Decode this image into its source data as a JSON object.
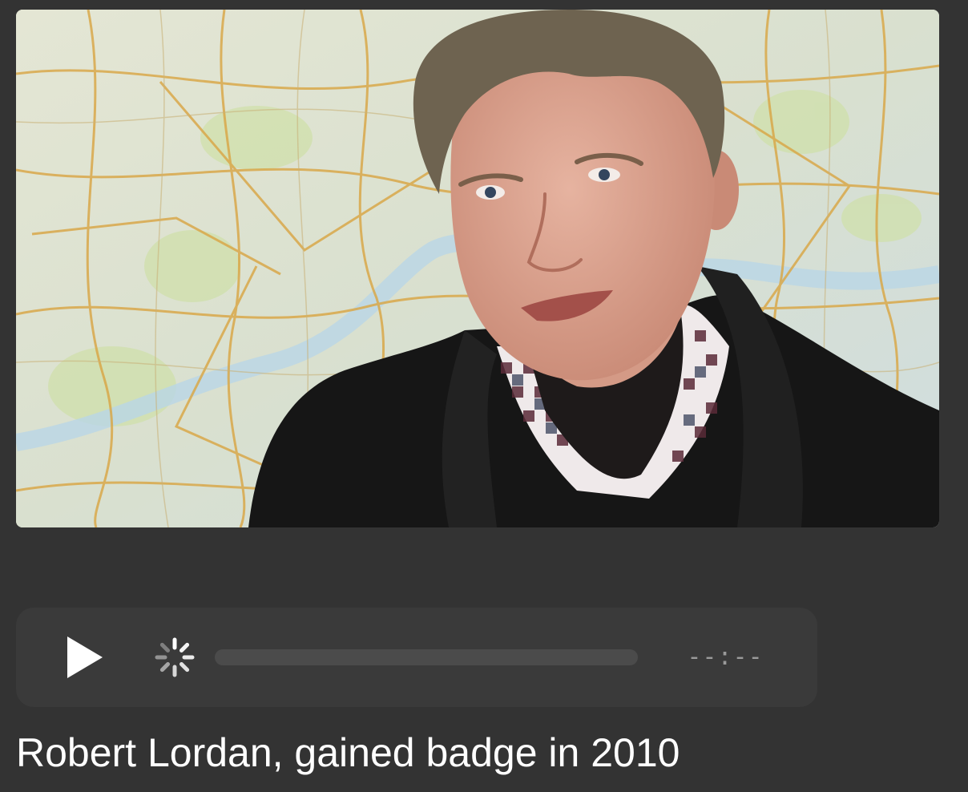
{
  "video": {
    "state": "loading",
    "progress": 0,
    "time_display": "--:--"
  },
  "controls": {
    "play_icon": "play-icon",
    "loading_icon": "loading-spinner-icon"
  },
  "caption": "Robert Lordan, gained badge in 2010",
  "colors": {
    "background": "#333333",
    "player_bar": "#3a3a3a",
    "track": "#4b4b4b",
    "time_text": "#9a9a9a",
    "caption_text": "#ffffff"
  }
}
